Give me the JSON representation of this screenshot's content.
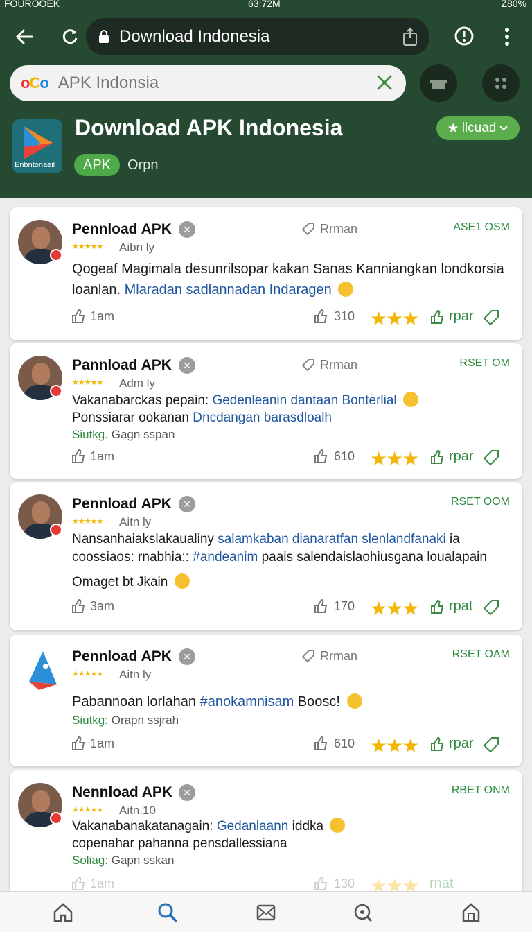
{
  "status_bar": {
    "carrier": "FOUROOEK",
    "time": "63:72M",
    "battery": "Z80%"
  },
  "browser": {
    "url": "Download Indonesia"
  },
  "search": {
    "placeholder": "APK Indonsia",
    "logo": "oCo"
  },
  "app": {
    "icon_label": "Enbntonaeil",
    "title": "Download APK Indonesia",
    "chip": "APK",
    "subtitle": "Orpn",
    "rating_button": "llcuad"
  },
  "reviews": [
    {
      "name": "Pennload APK",
      "stars": "★★★★★",
      "handle": "Aibn ly",
      "action": "Rrman",
      "status": "ASE1 OSM",
      "text": "Qogeaf Magimala desunrilsopar kakan Sanas Kanniangkan londkorsia",
      "text2": "loanlan.",
      "link": "Mlaradan sadlannadan Indaragen",
      "time": "1am",
      "count": "310",
      "big_stars": "★★★",
      "reply": "rpar"
    },
    {
      "name": "Pannload APK",
      "stars": "★★★★★",
      "handle": "Adm ly",
      "action": "Rrman",
      "status": "RSET OM",
      "text": "Vakanabarckas pepain:",
      "link": "Gedenleanin dantaan Bonterlial",
      "text2": "Ponssiarar ookanan",
      "link2": "Dncdangan barasdloalh",
      "sub_green": "Siutkg.",
      "sub": "Gagn sspan",
      "time": "1am",
      "count": "610",
      "big_stars": "★★★",
      "reply": "rpar"
    },
    {
      "name": "Pennload APK",
      "stars": "★★★★★",
      "handle": "Aitn ly",
      "action": "",
      "status": "RSET OOM",
      "text": "Nansanhaiakslakaualiny",
      "link": "salamkaban dianaratfan slenlandfanaki",
      "text_end": "ia",
      "text2": "coossiaos: rnabhia::",
      "link2": "#andeanim",
      "text2_end": "paais salendaislaohiusgana loualapain",
      "text3": "Omaget bt Jkain",
      "time": "3am",
      "count": "170",
      "big_stars": "★★★",
      "reply": "rpat"
    },
    {
      "name": "Pennload APK",
      "stars": "★★★★★",
      "handle": "Aitn ly",
      "action": "Rrman",
      "status": "RSET OAM",
      "text": "Pabannoan lorlahan",
      "link": "#anokamnisam",
      "text_end": "Boosc!",
      "sub_green": "Siutkg:",
      "sub": "Orapn ssjrah",
      "time": "1am",
      "count": "610",
      "big_stars": "★★★",
      "reply": "rpar"
    },
    {
      "name": "Nennload APK",
      "stars": "★★★★★",
      "handle": "Aitn.10",
      "action": "",
      "status": "RBET ONM",
      "text": "Vakanabanakatanagain:",
      "link": "Gedanlaann",
      "text_end": "iddka",
      "text2": "copenahar pahanna pensdallessiana",
      "sub_green": "Soliag:",
      "sub": "Gapn sskan",
      "time": "1am",
      "count": "130",
      "big_stars": "★★★",
      "reply": "rnat"
    }
  ],
  "colors": {
    "header": "#264a31",
    "accent_green": "#5cad4d",
    "link_blue": "#1e56a0",
    "star": "#f2b705"
  }
}
